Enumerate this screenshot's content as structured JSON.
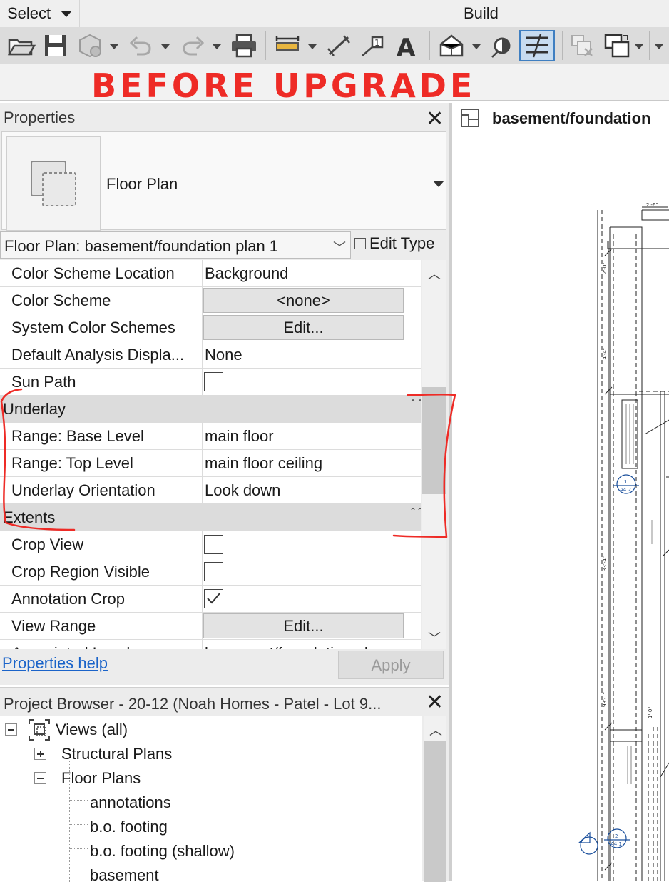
{
  "ribbon": {
    "select_label": "Select",
    "build_label": "Build"
  },
  "banner": {
    "text": "BEFORE  UPGRADE",
    "color": "#ee2b26"
  },
  "toolbar": {
    "icons": [
      "open-icon",
      "save-icon",
      "sync-icon",
      "undo-icon",
      "redo-icon",
      "print-icon",
      "measure-icon",
      "dimension-icon",
      "tag-icon",
      "text-icon",
      "3d-view-icon",
      "section-icon",
      "thin-lines-icon",
      "close-hidden-icon",
      "switch-windows-icon"
    ]
  },
  "properties": {
    "title": "Properties",
    "type_name": "Floor Plan",
    "view_selector": "Floor Plan: basement/foundation plan 1",
    "edit_type": "Edit Type",
    "rows": {
      "color_scheme_location": {
        "label": "Color Scheme Location",
        "value": "Background"
      },
      "color_scheme": {
        "label": "Color Scheme",
        "value": "<none>"
      },
      "system_color_schemes": {
        "label": "System Color Schemes",
        "value": "Edit..."
      },
      "default_analysis": {
        "label": "Default Analysis Displa...",
        "value": "None"
      },
      "sun_path": {
        "label": "Sun Path",
        "checked": false
      },
      "underlay_section": {
        "label": "Underlay"
      },
      "range_base": {
        "label": "Range: Base Level",
        "value": "main floor"
      },
      "range_top": {
        "label": "Range: Top Level",
        "value": "main floor ceiling"
      },
      "underlay_orientation": {
        "label": "Underlay Orientation",
        "value": "Look down"
      },
      "extents_section": {
        "label": "Extents"
      },
      "crop_view": {
        "label": "Crop View",
        "checked": false
      },
      "crop_region_visible": {
        "label": "Crop Region Visible",
        "checked": false
      },
      "annotation_crop": {
        "label": "Annotation Crop",
        "checked": true
      },
      "view_range": {
        "label": "View Range",
        "value": "Edit..."
      },
      "associated_level": {
        "label": "Associated Level",
        "value": "basement/foundation pl"
      }
    },
    "help_link": "Properties help",
    "apply": "Apply"
  },
  "project_browser": {
    "title": "Project Browser - 20-12 (Noah Homes - Patel - Lot 9...",
    "views_root": "Views (all)",
    "structural_plans": "Structural Plans",
    "floor_plans": "Floor Plans",
    "floor_plan_items": [
      "annotations",
      "b.o. footing",
      "b.o. footing (shallow)",
      "basement"
    ]
  },
  "view": {
    "tab_title": "basement/foundation",
    "dims": {
      "d1": "2'-6\"",
      "d2": "2'-0\"",
      "d3": "14'-4\"",
      "d4": "33'-4\"",
      "d5": "93'-1\"",
      "d6": "1'-0\""
    },
    "tags": {
      "t1_num": "1",
      "t1_sheet": "A4.2",
      "t2_num": "2",
      "t2_sheet": "A4.1"
    }
  }
}
